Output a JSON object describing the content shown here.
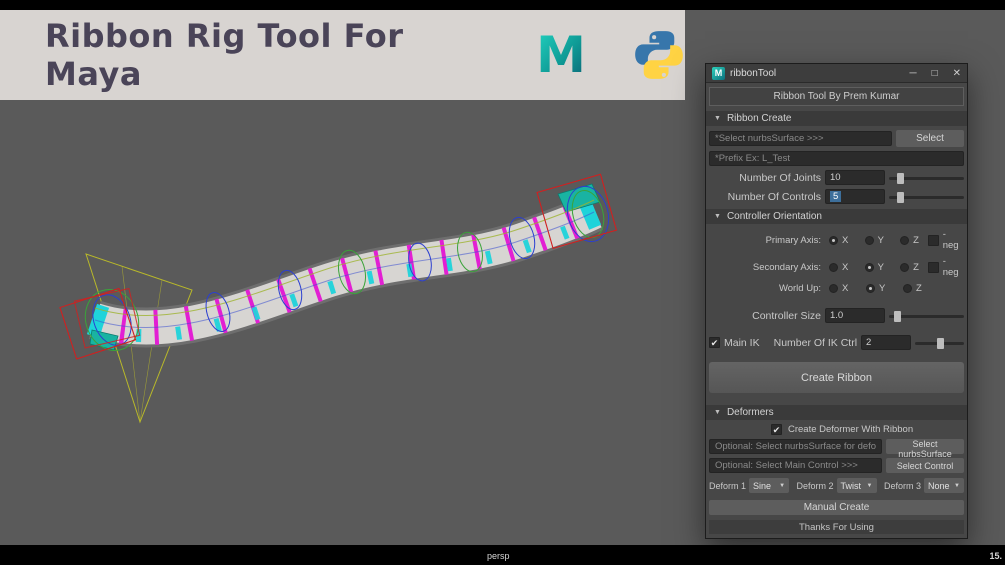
{
  "banner": {
    "title": "Ribbon Rig Tool For Maya"
  },
  "icons": {
    "minimize": "─",
    "maximize": "□",
    "close": "✕",
    "collapse": "▼",
    "dropdown": "▼",
    "check": "✔",
    "maya_mini": "M"
  },
  "viewport": {
    "camera": "persp",
    "frame": "15."
  },
  "win": {
    "title": "ribbonTool",
    "header": "Ribbon Tool By Prem Kumar",
    "create": {
      "section": "Ribbon Create",
      "surface_placeholder": "*Select nurbsSurface >>>",
      "select_btn": "Select",
      "prefix_placeholder": "*Prefix Ex: L_Test",
      "joints_label": "Number Of Joints",
      "joints_value": "10",
      "controls_label": "Number Of Controls",
      "controls_value": "5"
    },
    "orient": {
      "section": "Controller Orientation",
      "primary_label": "Primary Axis:",
      "secondary_label": "Secondary Axis:",
      "worldup_label": "World Up:",
      "x": "X",
      "y": "Y",
      "z": "Z",
      "neg": "-neg",
      "size_label": "Controller Size",
      "size_value": "1.0",
      "main_ik": "Main IK",
      "ik_label": "Number Of IK Ctrl",
      "ik_value": "2",
      "create_btn": "Create Ribbon"
    },
    "deform": {
      "section": "Deformers",
      "with_ribbon": "Create Deformer With Ribbon",
      "surface_placeholder": "Optional: Select nurbsSurface for deformer >>>",
      "surface_btn": "Select nurbsSurface",
      "control_placeholder": "Optional: Select Main Control >>>",
      "control_btn": "Select Control",
      "d1_label": "Deform 1",
      "d1_value": "Sine",
      "d2_label": "Deform 2",
      "d2_value": "Twist",
      "d3_label": "Deform 3",
      "d3_value": "None",
      "manual_btn": "Manual Create",
      "footer": "Thanks For Using"
    }
  },
  "colors": {
    "maya_teal": "#14b0a5",
    "python_blue": "#3776ab",
    "python_yellow": "#ffd343",
    "selection_blue": "#3d6f9b",
    "banner_bg": "#d8d4d1",
    "title_text": "#4a4458"
  }
}
